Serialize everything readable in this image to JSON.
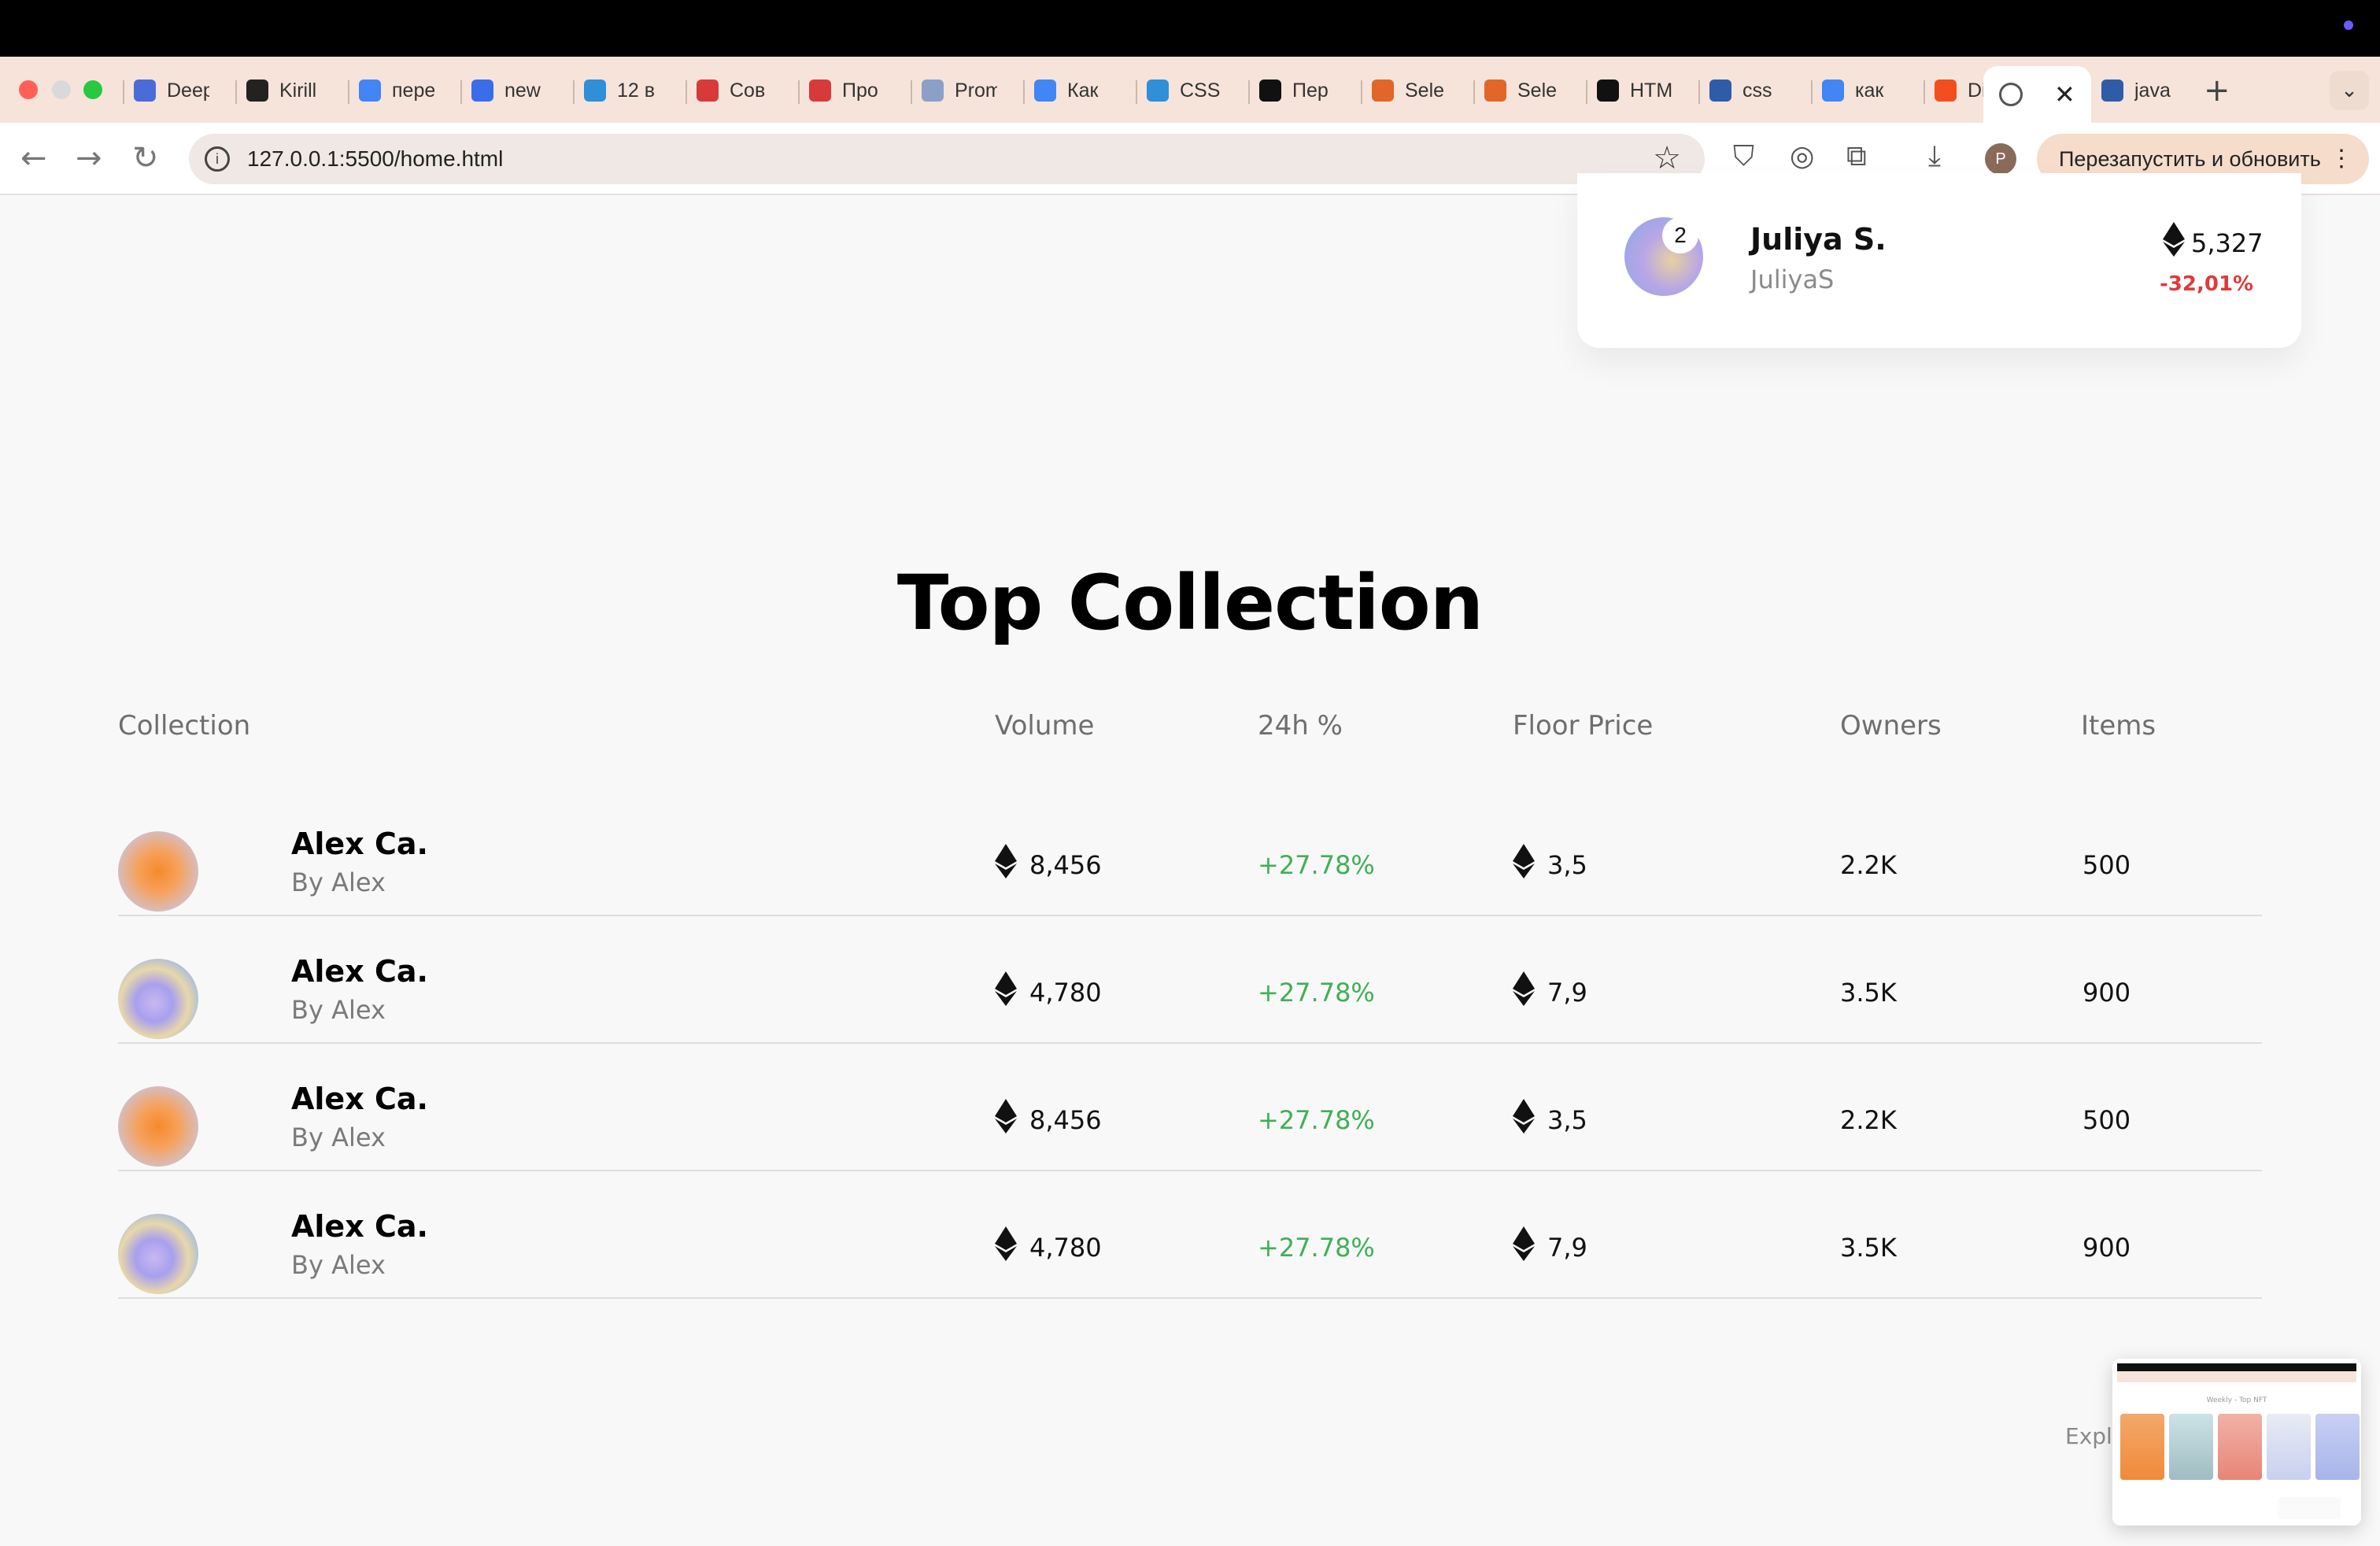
{
  "browser": {
    "tabs": [
      {
        "label": "Deepl",
        "color": "#4b6bd8"
      },
      {
        "label": "Kirill",
        "color": "#222222"
      },
      {
        "label": "переводчик",
        "color": "#4285f4"
      },
      {
        "label": "new",
        "color": "#3a6ee8"
      },
      {
        "label": "12 в",
        "color": "#2f8fd8"
      },
      {
        "label": "Сов",
        "color": "#d83a3a"
      },
      {
        "label": "Про",
        "color": "#d83a3a"
      },
      {
        "label": "Prom",
        "color": "#8aa0c8"
      },
      {
        "label": "Как",
        "color": "#4285f4"
      },
      {
        "label": "CSS",
        "color": "#2f8fd8"
      },
      {
        "label": "Пер",
        "color": "#111111"
      },
      {
        "label": "Sele",
        "color": "#e0662a"
      },
      {
        "label": "Sele",
        "color": "#e0662a"
      },
      {
        "label": "HTML",
        "color": "#111111"
      },
      {
        "label": "css",
        "color": "#2f5ca8"
      },
      {
        "label": "как",
        "color": "#4285f4"
      },
      {
        "label": "Dive",
        "color": "#f24e1e"
      }
    ],
    "active_tab_icon": "globe-icon",
    "after_tab": {
      "label": "java",
      "color": "#2f5ca8"
    },
    "url": "127.0.0.1:5500/home.html",
    "profile_initial": "P",
    "relaunch_label": "Перезапустить и обновить"
  },
  "top_seller": {
    "rank": "2",
    "name": "Juliya S.",
    "handle": "JuliyaS",
    "value": "5,327",
    "change": "-32,01%",
    "change_color": "#e03a3a"
  },
  "section": {
    "title": "Top Collection",
    "columns": {
      "collection": "Collection",
      "volume": "Volume",
      "change": "24h %",
      "floor": "Floor Price",
      "owners": "Owners",
      "items": "Items"
    },
    "rows": [
      {
        "thumb": "orange",
        "name": "Alex Ca.",
        "by": "By Alex",
        "volume": "8,456",
        "change": "+27.78%",
        "floor": "3,5",
        "owners": "2.2K",
        "items": "500"
      },
      {
        "thumb": "blue",
        "name": "Alex Ca.",
        "by": "By Alex",
        "volume": "4,780",
        "change": "+27.78%",
        "floor": "7,9",
        "owners": "3.5K",
        "items": "900"
      },
      {
        "thumb": "orange",
        "name": "Alex Ca.",
        "by": "By Alex",
        "volume": "8,456",
        "change": "+27.78%",
        "floor": "3,5",
        "owners": "2.2K",
        "items": "500"
      },
      {
        "thumb": "blue",
        "name": "Alex Ca.",
        "by": "By Alex",
        "volume": "4,780",
        "change": "+27.78%",
        "floor": "7,9",
        "owners": "3.5K",
        "items": "900"
      }
    ],
    "positive_color": "#3fb055"
  },
  "explore_label": "Explore",
  "preview": {
    "title": "Weekly - Top NFT"
  }
}
